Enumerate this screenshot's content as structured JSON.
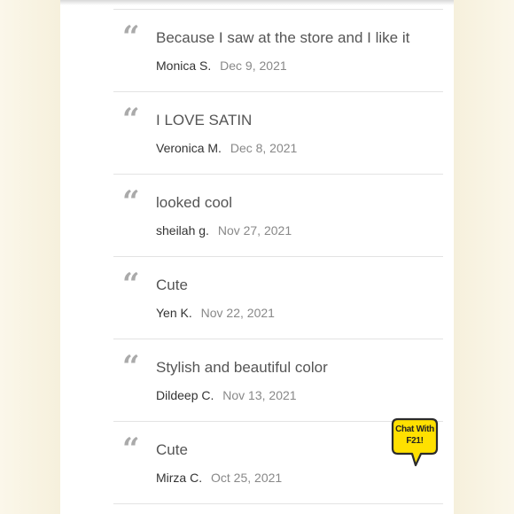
{
  "reviews": [
    {
      "text": "Because I saw at the store and I like it",
      "author": "Monica S.",
      "date": "Dec 9, 2021"
    },
    {
      "text": "I LOVE SATIN",
      "author": "Veronica M.",
      "date": "Dec 8, 2021"
    },
    {
      "text": "looked cool",
      "author": "sheilah g.",
      "date": "Nov 27, 2021"
    },
    {
      "text": "Cute",
      "author": "Yen K.",
      "date": "Nov 22, 2021"
    },
    {
      "text": "Stylish and beautiful color",
      "author": "Dildeep C.",
      "date": "Nov 13, 2021"
    },
    {
      "text": "Cute",
      "author": "Mirza C.",
      "date": "Oct 25, 2021"
    }
  ],
  "quote_glyph": "“",
  "chat": {
    "line1": "Chat With",
    "line2": "F21!",
    "icon": "speech-bubble-icon",
    "color": "#ffe000"
  }
}
